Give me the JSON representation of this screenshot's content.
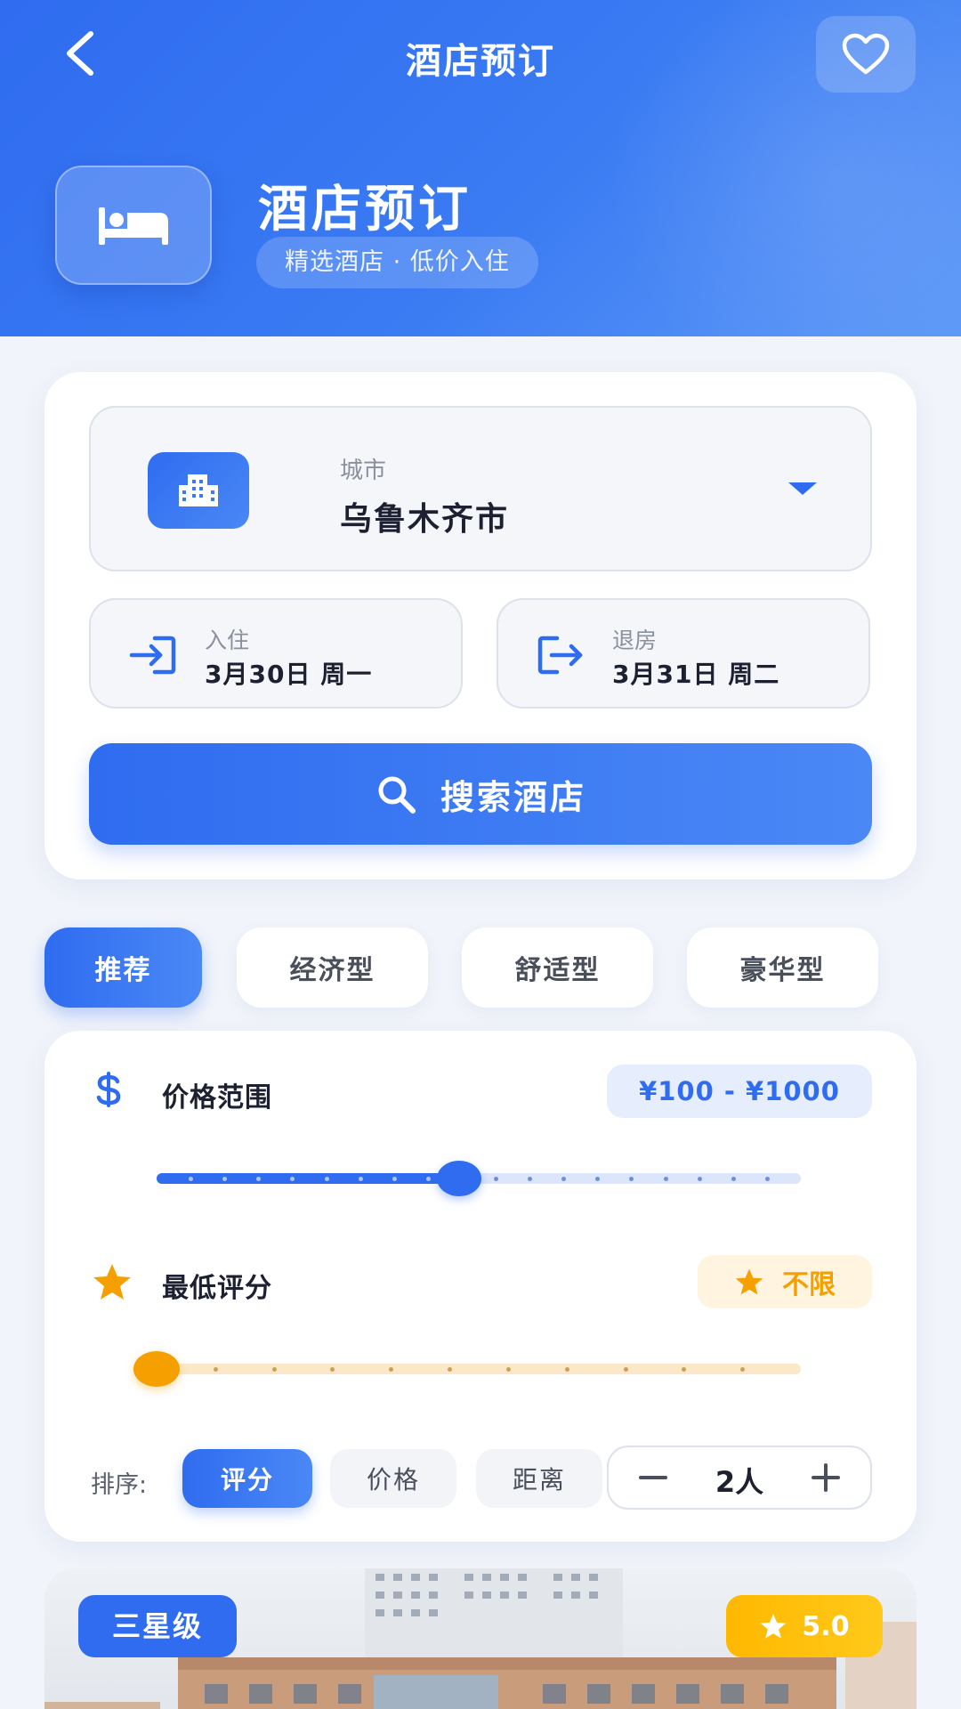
{
  "nav": {
    "title": "酒店预订"
  },
  "hero": {
    "title": "酒店预订",
    "subtitle": "精选酒店 · 低价入住"
  },
  "search": {
    "city_label": "城市",
    "city_value": "乌鲁木齐市",
    "checkin_label": "入住",
    "checkin_value": "3月30日 周一",
    "checkout_label": "退房",
    "checkout_value": "3月31日 周二",
    "button_label": "搜索酒店"
  },
  "tabs": [
    {
      "label": "推荐",
      "active": true
    },
    {
      "label": "经济型",
      "active": false
    },
    {
      "label": "舒适型",
      "active": false
    },
    {
      "label": "豪华型",
      "active": false
    }
  ],
  "filters": {
    "price_label": "价格范围",
    "price_value": "¥100 - ¥1000",
    "price_slider_fraction": 0.47,
    "rating_label": "最低评分",
    "rating_value": "不限",
    "rating_slider_fraction": 0.0,
    "sort_label": "排序:",
    "sort_options": [
      "评分",
      "价格",
      "距离"
    ],
    "sort_active": "评分",
    "guests_value": "2人"
  },
  "hotel": {
    "star_level": "三星级",
    "score": "5.0"
  },
  "colors": {
    "primary": "#2f6cf0",
    "accent_orange": "#f5a000",
    "gold": "#ffb800",
    "track_light_blue": "#dbe5fb",
    "track_light_orange": "#fbe8c8"
  },
  "icons": {
    "back": "chevron-left-icon",
    "favorite": "heart-icon",
    "hero": "bed-icon",
    "city": "building-icon",
    "checkin": "login-arrow-icon",
    "checkout": "logout-arrow-icon",
    "search": "search-icon",
    "price": "dollar-icon",
    "rating": "star-icon"
  }
}
